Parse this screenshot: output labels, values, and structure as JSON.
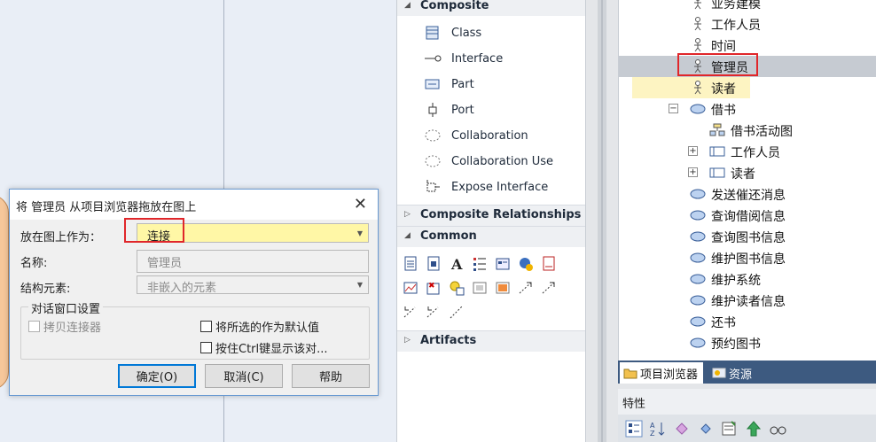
{
  "dialog": {
    "title": "将 管理员 从项目浏览器拖放在图上",
    "drop_as_label": "放在图上作为：",
    "drop_as_value": "连接",
    "name_label": "名称:",
    "name_value": "管理员",
    "struct_label": "结构元素:",
    "struct_value": "非嵌入的元素",
    "group_title": "对话窗口设置",
    "copy_connectors": "拷贝连接器",
    "save_default": "将所选的作为默认值",
    "ctrl_show": "按住Ctrl键显示该对...",
    "ok": "确定(O)",
    "cancel": "取消(C)",
    "help": "帮助"
  },
  "toolbox": {
    "sec_composite": "Composite",
    "items": [
      {
        "label": "Class",
        "icon": "class-icon"
      },
      {
        "label": "Interface",
        "icon": "interface-icon"
      },
      {
        "label": "Part",
        "icon": "part-icon"
      },
      {
        "label": "Port",
        "icon": "port-icon"
      },
      {
        "label": "Collaboration",
        "icon": "collaboration-icon"
      },
      {
        "label": "Collaboration Use",
        "icon": "collaboration-use-icon"
      },
      {
        "label": "Expose Interface",
        "icon": "expose-interface-icon"
      }
    ],
    "sec_composite_rel": "Composite Relationships",
    "sec_common": "Common",
    "sec_artifacts": "Artifacts"
  },
  "browser": {
    "rows": [
      {
        "label": "业务建模",
        "icon": "actor-icon"
      },
      {
        "label": "工作人员",
        "icon": "actor-icon"
      },
      {
        "label": "时间",
        "icon": "actor-icon"
      },
      {
        "label": "管理员",
        "icon": "actor-icon"
      },
      {
        "label": "读者",
        "icon": "actor-icon"
      },
      {
        "label": "借书",
        "icon": "usecase-icon",
        "expander": "⊟"
      },
      {
        "label": "借书活动图",
        "icon": "activity-diagram-icon"
      },
      {
        "label": "工作人员",
        "icon": "partition-icon",
        "expander": "+"
      },
      {
        "label": "读者",
        "icon": "partition-icon",
        "expander": "+"
      },
      {
        "label": "发送催还消息",
        "icon": "usecase-icon"
      },
      {
        "label": "查询借阅信息",
        "icon": "usecase-icon"
      },
      {
        "label": "查询图书信息",
        "icon": "usecase-icon"
      },
      {
        "label": "维护图书信息",
        "icon": "usecase-icon"
      },
      {
        "label": "维护系统",
        "icon": "usecase-icon"
      },
      {
        "label": "维护读者信息",
        "icon": "usecase-icon"
      },
      {
        "label": "还书",
        "icon": "usecase-icon"
      },
      {
        "label": "预约图书",
        "icon": "usecase-icon"
      }
    ]
  },
  "tabs": {
    "project_browser": "项目浏览器",
    "resources": "资源"
  },
  "props": {
    "title": "特性"
  }
}
